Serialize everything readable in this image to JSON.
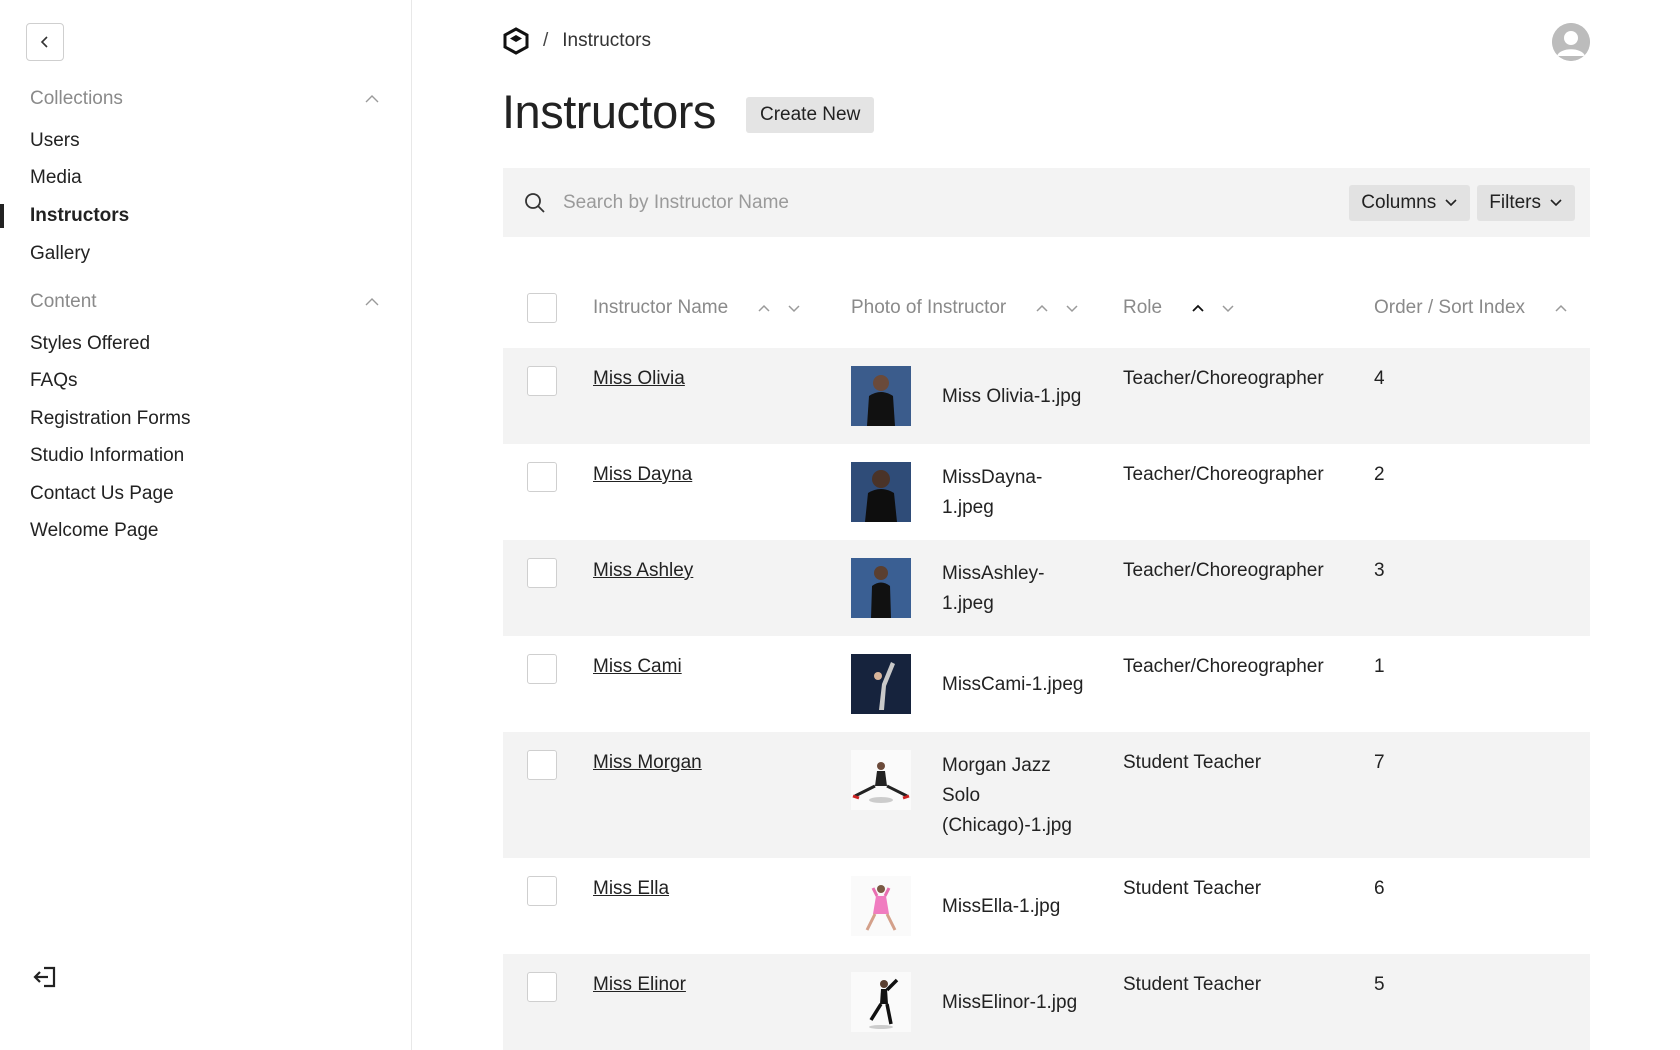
{
  "sidebar": {
    "groups": [
      {
        "label": "Collections",
        "items": [
          "Users",
          "Media",
          "Instructors",
          "Gallery"
        ]
      },
      {
        "label": "Content",
        "items": [
          "Styles Offered",
          "FAQs",
          "Registration Forms",
          "Studio Information",
          "Contact Us Page",
          "Welcome Page"
        ]
      }
    ],
    "active_item": "Instructors"
  },
  "breadcrumb": {
    "separator": "/",
    "current": "Instructors"
  },
  "page": {
    "title": "Instructors",
    "create_label": "Create New"
  },
  "search": {
    "placeholder": "Search by Instructor Name",
    "columns_label": "Columns",
    "filters_label": "Filters"
  },
  "table": {
    "headers": [
      "Instructor Name",
      "Photo of Instructor",
      "Role",
      "Order / Sort Index"
    ],
    "rows": [
      {
        "name": "Miss Olivia",
        "file_lines": [
          "Miss Olivia-1.jpg"
        ],
        "role": "Teacher/Choreographer",
        "order": "4"
      },
      {
        "name": "Miss Dayna",
        "file_lines": [
          "MissDayna-",
          "1.jpeg"
        ],
        "role": "Teacher/Choreographer",
        "order": "2"
      },
      {
        "name": "Miss Ashley",
        "file_lines": [
          "MissAshley-",
          "1.jpeg"
        ],
        "role": "Teacher/Choreographer",
        "order": "3"
      },
      {
        "name": "Miss Cami",
        "file_lines": [
          "MissCami-1.jpeg"
        ],
        "role": "Teacher/Choreographer",
        "order": "1"
      },
      {
        "name": "Miss Morgan",
        "file_lines": [
          "Morgan Jazz",
          "Solo",
          "(Chicago)-1.jpg"
        ],
        "role": "Student Teacher",
        "order": "7"
      },
      {
        "name": "Miss Ella",
        "file_lines": [
          "MissElla-1.jpg"
        ],
        "role": "Student Teacher",
        "order": "6"
      },
      {
        "name": "Miss Elinor",
        "file_lines": [
          "MissElinor-1.jpg"
        ],
        "role": "Student Teacher",
        "order": "5"
      }
    ]
  },
  "colors": {
    "accent_text": "#222222",
    "muted_text": "#8a8a8a",
    "row_shade": "#f3f3f3",
    "button_bg": "#e4e4e4"
  },
  "icons": [
    "chevron-left-icon",
    "chevron-up-icon",
    "brand-logo-icon",
    "user-avatar-icon",
    "search-icon",
    "chevron-down-icon",
    "logout-icon",
    "photo-thumbnail"
  ]
}
